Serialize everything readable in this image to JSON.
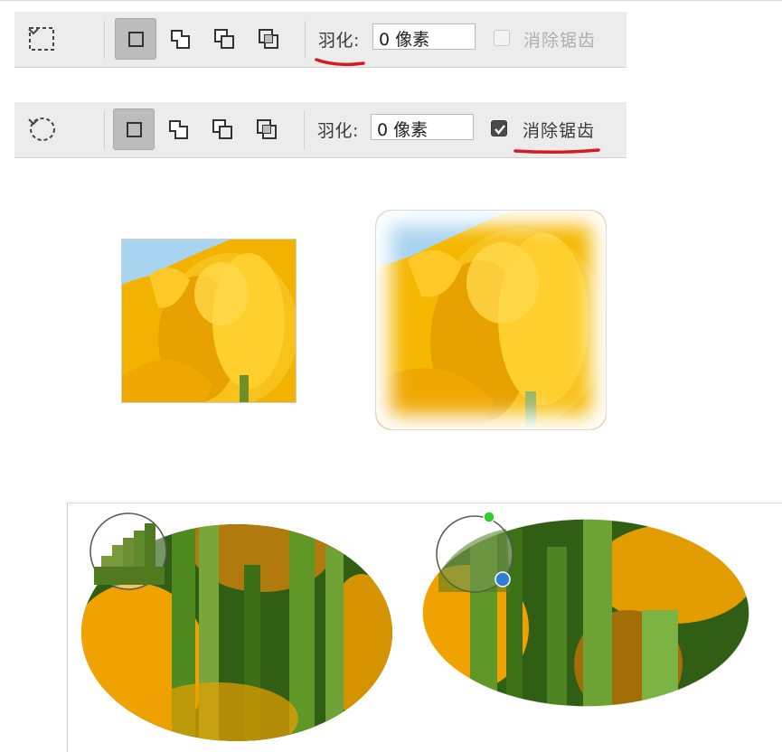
{
  "toolbar_rect": {
    "tool_icon": "rectangular-marquee-icon",
    "feather_label": "羽化:",
    "feather_value": "0 像素",
    "antialias_label": "消除锯齿",
    "antialias_checked": false,
    "highlight": "feather"
  },
  "toolbar_ellipse": {
    "tool_icon": "elliptical-marquee-icon",
    "feather_label": "羽化:",
    "feather_value": "0 像素",
    "antialias_label": "消除锯齿",
    "antialias_checked": true,
    "highlight": "antialias"
  },
  "selection_modes": [
    "new-selection-icon",
    "add-to-selection-icon",
    "subtract-from-selection-icon",
    "intersect-selection-icon"
  ],
  "colors": {
    "underline_red": "#d61a22",
    "petal_yellow": "#f5b400",
    "sky_blue": "#a8d3ee",
    "stem_green": "#3f7a1c",
    "handle_green": "#2fcf2f",
    "handle_blue": "#2f7fd6"
  }
}
